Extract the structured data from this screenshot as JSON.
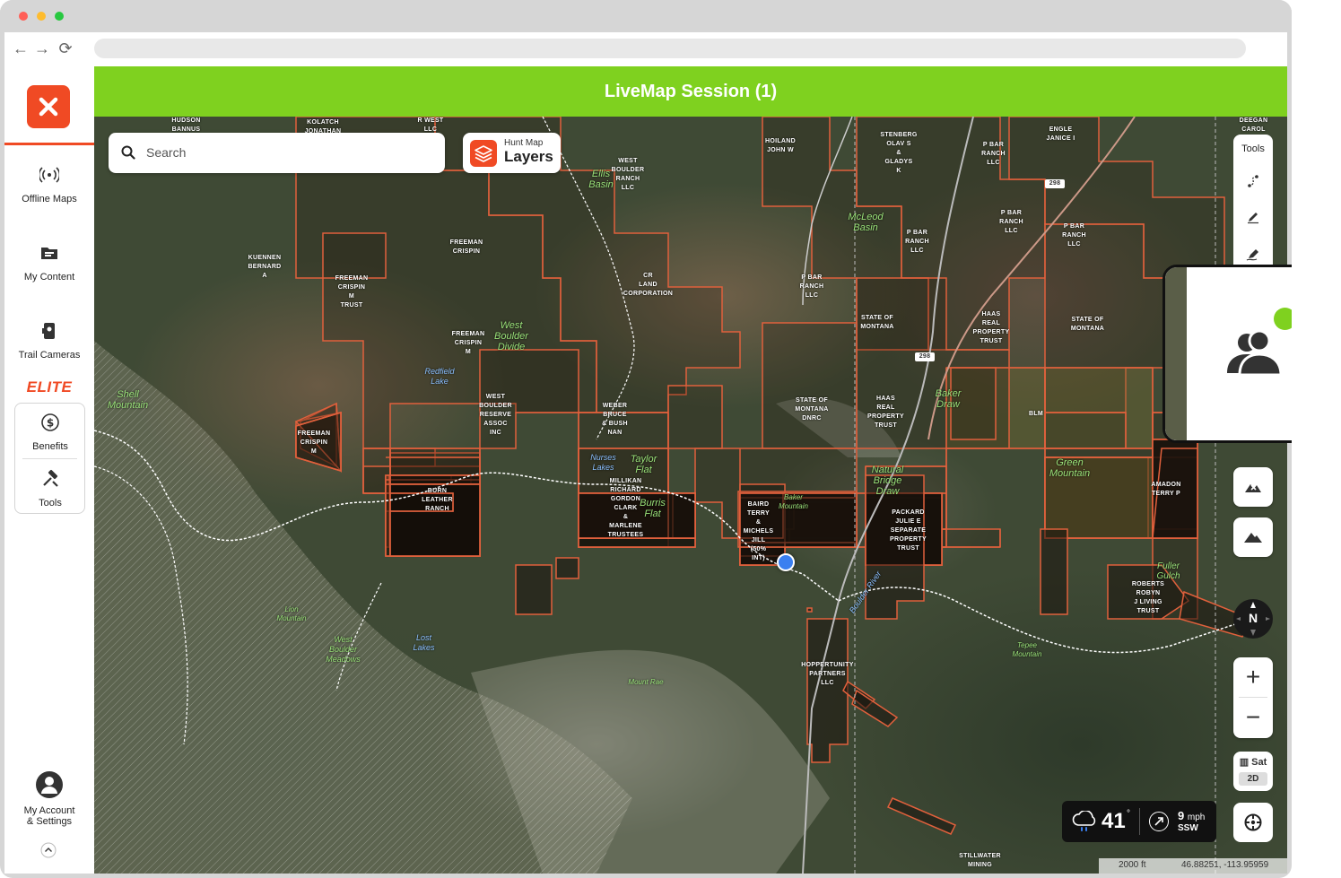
{
  "window": {
    "close_color": "#ff5f57",
    "min_color": "#febc2e",
    "max_color": "#28c840"
  },
  "browser": {
    "back": "←",
    "forward": "→",
    "reload": "⟳"
  },
  "header": {
    "title": "LiveMap Session (1)",
    "color": "#7fd11f"
  },
  "brand": {
    "accent": "#f04a24",
    "logo_icon": "x-logo-icon"
  },
  "sidebar": {
    "items": [
      {
        "label": "Offline Maps",
        "icon": "broadcast-icon"
      },
      {
        "label": "My Content",
        "icon": "folder-icon"
      },
      {
        "label": "Trail Cameras",
        "icon": "trail-camera-icon"
      }
    ],
    "elite_label": "ELITE",
    "elite_items": [
      {
        "label": "Benefits",
        "icon": "dollar-icon"
      },
      {
        "label": "Tools",
        "icon": "tools-icon"
      }
    ],
    "account_label_1": "My Account",
    "account_label_2": "& Settings"
  },
  "search": {
    "placeholder": "Search"
  },
  "layers": {
    "top": "Hunt Map",
    "main": "Layers"
  },
  "tools": {
    "label": "Tools"
  },
  "map": {
    "property_labels": [
      "HUDSON\nBANNUS",
      "KOLATCH\nJONATHAN",
      "R WEST\nLLC",
      "HOILAND\nJOHN W",
      "WEST\nBOULDER\nRANCH\nLLC",
      "STENBERG\nOLAV S\n&\nGLADYS\nK",
      "P BAR\nRANCH\nLLC",
      "ENGLE\nJANICE I",
      "DEEGAN\nCAROL",
      "KUENNEN\nBERNARD\nA",
      "FREEMAN\nCRISPIN",
      "FREEMAN\nCRISPIN\nM\nTRUST",
      "CR\nLAND\nCORPORATION",
      "P BAR\nRANCH\nLLC",
      "P BAR\nRANCH\nLLC",
      "P BAR\nRANCH\nLLC",
      "P BAR\nRANCH\nLLC",
      "STATE OF\nMONTANA",
      "HAAS\nREAL\nPROPERTY\nTRUST",
      "STATE OF\nMONTANA",
      "FREEMAN\nCRISPIN\nM",
      "WEST\nBOULDER\nRESERVE\nASSOC\nINC",
      "WEBER\nBRUCE\n& BUSH\nNAN",
      "STATE OF\nMONTANA\nDNRC",
      "HAAS\nREAL\nPROPERTY\nTRUST",
      "BLM",
      "FREEMAN\nCRISPIN\nM",
      "BURN\nLEATHER\nRANCH",
      "MILLIKAN\nRICHARD\nGORDON\nCLARK\n&\nMARLENE\nTRUSTEES",
      "BAIRD\nTERRY\n&\nMICHELS\nJILL\n(50%\nINT)",
      "PACKARD\nJULIE E\nSEPARATE\nPROPERTY\nTRUST",
      "AMADON\nTERRY P",
      "ROBERTS\nROBYN\nJ LIVING\nTRUST",
      "HOPPERTUNITY\nPARTNERS\nLLC",
      "STILLWATER\nMINING"
    ],
    "feature_labels": [
      "Ellis\nBasin",
      "McLeod\nBasin",
      "West\nBoulder\nDivide",
      "Shell\nMountain",
      "Taylor\nFlat",
      "Burris\nFlat",
      "Green\nMountain",
      "Natural\nBridge\nDraw",
      "Baker\nDraw",
      "Lion\nMountain",
      "West\nBoulder\nMeadows",
      "Mount Rae",
      "Tepee\nMountain",
      "Baker\nMountain",
      "Fuller\nGulch"
    ],
    "water_labels": [
      "Redfield\nLake",
      "Nurses\nLakes",
      "Lost\nLakes",
      "Boulder River"
    ],
    "route_labels": [
      "298",
      "298"
    ]
  },
  "controls": {
    "compass_label": "N",
    "zoom_in": "+",
    "zoom_out": "−",
    "basemap_label": "Sat",
    "dimension_label": "2D"
  },
  "weather": {
    "temp": "41",
    "deg": "°",
    "wind_speed": "9",
    "wind_unit": "mph",
    "wind_dir": "SSW"
  },
  "status": {
    "scale": "2000 ft",
    "coordinates": "46.88251, -113.95959"
  }
}
